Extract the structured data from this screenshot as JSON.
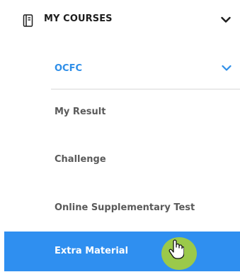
{
  "menu": {
    "section": {
      "label": "MY COURSES",
      "icon": "notebook-icon",
      "chevron": "chevron-down-icon"
    },
    "subsection": {
      "label": "OCFC",
      "chevron": "chevron-down-icon",
      "accent_color": "#2e8ee8"
    },
    "items": [
      {
        "label": "My Result"
      },
      {
        "label": "Challenge"
      },
      {
        "label": "Online Supplementary Test"
      },
      {
        "label": "Extra Material",
        "active": true
      }
    ],
    "active_color": "#2f8ff0"
  },
  "cursor": {
    "icon": "hand-pointer-icon",
    "halo_color": "#9bc94a"
  }
}
